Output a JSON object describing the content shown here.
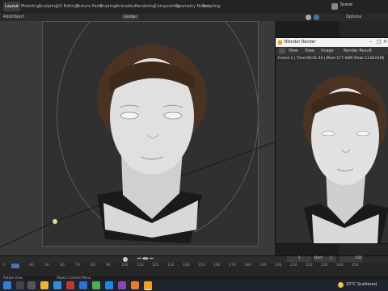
{
  "workspace_tabs": [
    "Layout",
    "Modeling",
    "Sculpting",
    "UV Editing",
    "Texture Paint",
    "Shading",
    "Animation",
    "Rendering",
    "Compositing",
    "Geometry Nodes",
    "Scripting"
  ],
  "scene_label": "Scene",
  "header": {
    "add": "Add",
    "object": "Object",
    "transform": "Global",
    "options": "Options"
  },
  "render_window": {
    "title": "Blender Render",
    "menu": [
      "View",
      "View",
      "Image"
    ],
    "slot": "Render Result",
    "status": "Frame:1 | Time:00:01.40 | Mem:177.44M (Peak 1138.01M)"
  },
  "timeline": {
    "ticks": [
      "0",
      "40",
      "50",
      "60",
      "70",
      "80",
      "90",
      "100",
      "110",
      "120",
      "130",
      "140",
      "150",
      "160",
      "170",
      "180",
      "190",
      "200",
      "210",
      "220",
      "230",
      "240",
      "250"
    ],
    "start_label": "Start",
    "start_value": "1",
    "end_value": "250",
    "current_frame": "1"
  },
  "status_bar": {
    "left": "Rotate View",
    "right": "Object Context Menu"
  },
  "taskbar": {
    "weather": "20°C Scattered",
    "icons": [
      "windows-start",
      "search",
      "task-view",
      "file-explorer",
      "edge",
      "mail",
      "store",
      "blender"
    ]
  },
  "colors": {
    "accent": "#4772b3",
    "viewport_bg": "#3a3a3a",
    "taskbar_bg": "#1f2430",
    "active_object": "#f0a020"
  }
}
